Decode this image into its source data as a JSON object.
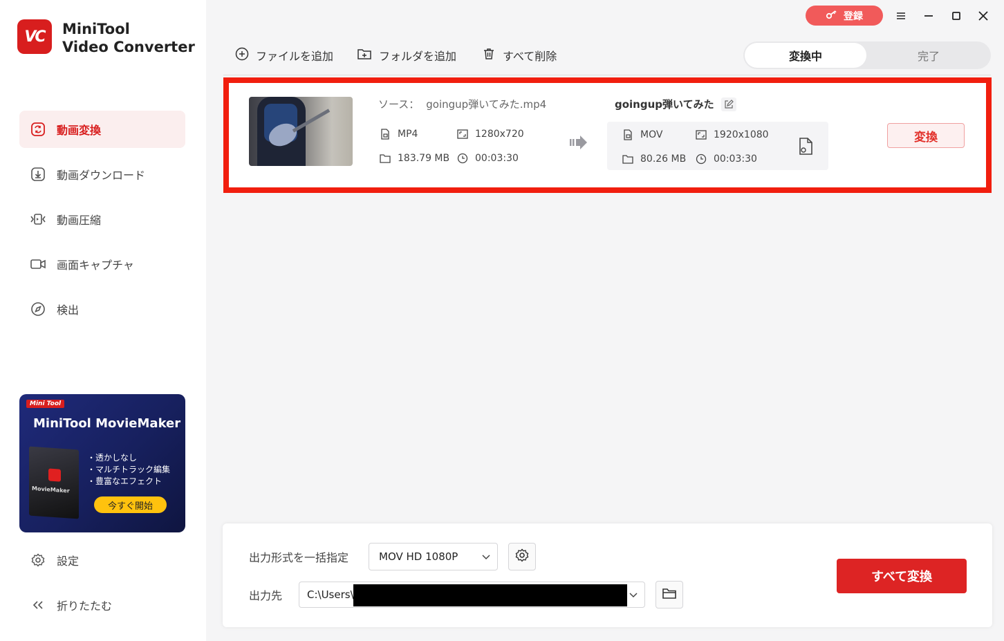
{
  "app": {
    "logo_text": "VC",
    "name_line1": "MiniTool",
    "name_line2": "Video Converter"
  },
  "sidebar": {
    "items": [
      {
        "label": "動画変換",
        "icon": "convert-icon",
        "active": true
      },
      {
        "label": "動画ダウンロード",
        "icon": "download-icon",
        "active": false
      },
      {
        "label": "動画圧縮",
        "icon": "compress-icon",
        "active": false
      },
      {
        "label": "画面キャプチャ",
        "icon": "camera-icon",
        "active": false
      },
      {
        "label": "検出",
        "icon": "compass-icon",
        "active": false
      }
    ],
    "settings_label": "設定",
    "collapse_label": "折りたたむ"
  },
  "promo": {
    "badge": "Mini Tool",
    "title": "MiniTool MovieMaker",
    "box_label": "MovieMaker",
    "features": [
      "・透かしなし",
      "・マルチトラック編集",
      "・豊富なエフェクト"
    ],
    "button_label": "今すぐ開始"
  },
  "titlebar": {
    "register_label": "登録"
  },
  "toolbar": {
    "add_file": "ファイルを追加",
    "add_folder": "フォルダを追加",
    "delete_all": "すべて削除"
  },
  "tabs": {
    "converting": "変換中",
    "done": "完了"
  },
  "file": {
    "source_prefix": "ソース：",
    "source_name": "goingup弾いてみた.mp4",
    "src_format": "MP4",
    "src_resolution": "1280x720",
    "src_size": "183.79 MB",
    "src_duration": "00:03:30",
    "output_name": "goingup弾いてみた",
    "out_format": "MOV",
    "out_resolution": "1920x1080",
    "out_size": "80.26 MB",
    "out_duration": "00:03:30",
    "convert_label": "変換"
  },
  "bottom": {
    "format_label": "出力形式を一括指定",
    "format_value": "MOV HD 1080P",
    "dest_label": "出力先",
    "dest_value": "C:\\Users\\",
    "convert_all_label": "すべて変換"
  },
  "colors": {
    "accent": "#d81e1e",
    "highlight": "#f11e0e",
    "promo_button": "#ffc20e"
  }
}
